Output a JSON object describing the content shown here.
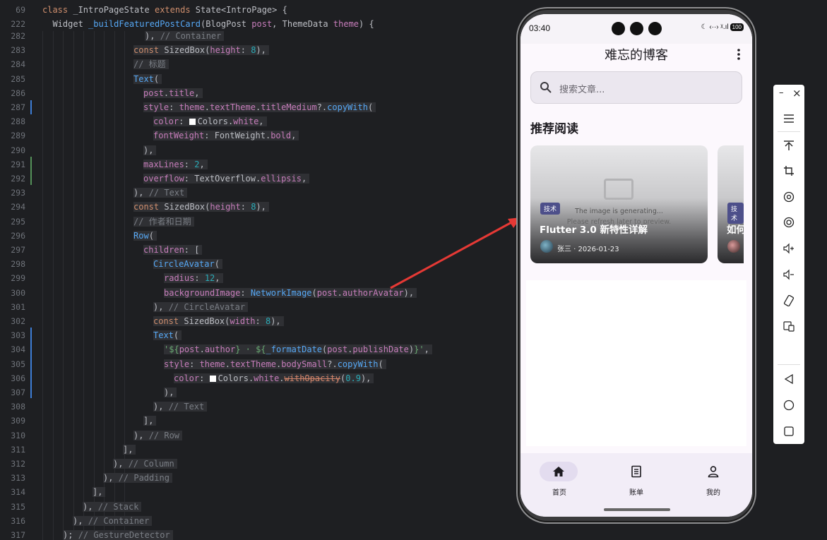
{
  "editor": {
    "sticky": [
      {
        "num": "69",
        "text": "class _IntroPageState extends State<IntroPage> {"
      },
      {
        "num": "222",
        "text": "  Widget _buildFeaturedPostCard(BlogPost post, ThemeData theme) {"
      }
    ],
    "lines": [
      {
        "num": "282"
      },
      {
        "num": "283"
      },
      {
        "num": "284"
      },
      {
        "num": "285"
      },
      {
        "num": "286"
      },
      {
        "num": "287"
      },
      {
        "num": "288"
      },
      {
        "num": "289"
      },
      {
        "num": "290"
      },
      {
        "num": "291"
      },
      {
        "num": "292"
      },
      {
        "num": "293"
      },
      {
        "num": "294"
      },
      {
        "num": "295"
      },
      {
        "num": "296"
      },
      {
        "num": "297"
      },
      {
        "num": "298"
      },
      {
        "num": "299"
      },
      {
        "num": "300"
      },
      {
        "num": "301"
      },
      {
        "num": "302"
      },
      {
        "num": "303"
      },
      {
        "num": "304"
      },
      {
        "num": "305"
      },
      {
        "num": "306"
      },
      {
        "num": "307"
      },
      {
        "num": "308"
      },
      {
        "num": "309"
      },
      {
        "num": "310"
      },
      {
        "num": "311"
      },
      {
        "num": "312"
      },
      {
        "num": "313"
      },
      {
        "num": "314"
      },
      {
        "num": "315"
      },
      {
        "num": "316"
      },
      {
        "num": "317"
      }
    ]
  },
  "phone": {
    "status": {
      "time": "03:40",
      "battery": "100",
      "icons_text": "☾ ‹··› ᵡ.ıl"
    },
    "app_title": "难忘的博客",
    "search_placeholder": "搜索文章...",
    "section_title": "推荐阅读",
    "card1": {
      "tag": "技术",
      "title": "Flutter 3.0 新特性详解",
      "meta": "张三 · 2026-01-23",
      "generating": "The image is generating...",
      "generating_hint": "Please refresh later to preview."
    },
    "card2": {
      "tag": "技术",
      "title": "如何"
    },
    "nav": [
      {
        "label": "首页",
        "icon": "home-icon",
        "active": true
      },
      {
        "label": "账单",
        "icon": "receipt-icon",
        "active": false
      },
      {
        "label": "我的",
        "icon": "person-icon",
        "active": false
      }
    ]
  },
  "toolbar": {
    "minimize": "–",
    "close": "×",
    "items": [
      "menu-icon",
      "pin-top-icon",
      "crop-icon",
      "rotate-icon",
      "screen-record-icon",
      "volume-up-icon",
      "volume-down-icon",
      "rotate-device-icon",
      "fold-icon",
      "back-icon",
      "home-circle-icon",
      "overview-icon"
    ]
  },
  "colors": {
    "accent": "#e53935",
    "editor_bg": "#1e1f22",
    "tag_bg": "#4d4f8a"
  }
}
